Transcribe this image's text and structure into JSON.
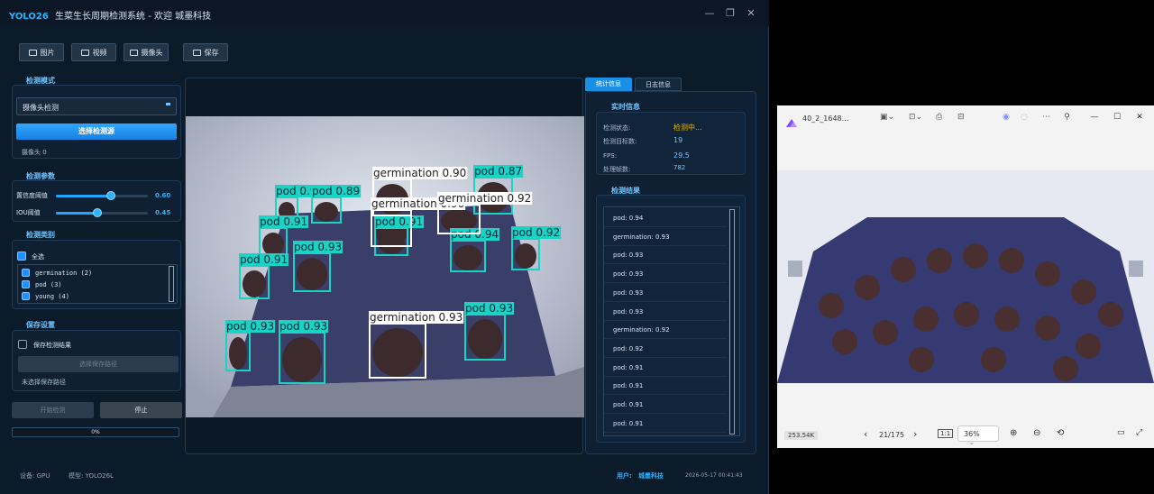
{
  "app": {
    "brand": "YOLO26",
    "title": "生菜生长周期检测系统 - 欢迎 城墨科技",
    "win": {
      "min": "—",
      "max": "❐",
      "close": "✕"
    }
  },
  "toolbar": {
    "image": "图片",
    "video": "视频",
    "camera": "摄像头",
    "save": "保存"
  },
  "mode": {
    "title": "检测模式",
    "selected": "摄像头检测",
    "button": "选择检测源",
    "camera_label": "摄像头 0"
  },
  "params": {
    "title": "检测参数",
    "conf_label": "置信度阈值",
    "conf_value": "0.60",
    "conf_fraction": 0.6,
    "iou_label": "IOU阈值",
    "iou_value": "0.45",
    "iou_fraction": 0.45
  },
  "classes": {
    "title": "检测类别",
    "all": "全选",
    "items": [
      "germination (2)",
      "pod (3)",
      "young (4)"
    ]
  },
  "save_settings": {
    "title": "保存设置",
    "save_results": "保存检测结果",
    "path_button": "选择保存路径",
    "path_hint": "未选择保存路径"
  },
  "actions": {
    "start": "开始检测",
    "stop": "停止"
  },
  "progress": {
    "text": "0%",
    "value": 0
  },
  "status": {
    "device": "设备: GPU",
    "model": "模型: YOLO26L",
    "user_label": "用户:",
    "user_name": "城墨科技",
    "datetime": "2026-05-17 00:41:43"
  },
  "detections": [
    {
      "label": "pod 0.91"
    },
    {
      "label": "pod 0.89"
    },
    {
      "label": "pod 0.91"
    },
    {
      "label": "pod 0.91"
    },
    {
      "label": "pod 0.93"
    },
    {
      "label": "pod 0.91"
    },
    {
      "label": "pod 0.94"
    },
    {
      "label": "pod 0.92"
    },
    {
      "label": "pod 0.87"
    },
    {
      "label": "germination 0.90"
    },
    {
      "label": "germination 0.90"
    },
    {
      "label": "germination 0.92"
    },
    {
      "label": "pod 0.93"
    },
    {
      "label": "pod 0.93"
    },
    {
      "label": "germination 0.93"
    },
    {
      "label": "pod 0.93"
    }
  ],
  "right_tabs": {
    "stats": "统计信息",
    "log": "日志信息"
  },
  "realtime": {
    "title": "实时信息",
    "rows": [
      {
        "label": "检测状态:",
        "value": "检测中..."
      },
      {
        "label": "检测目标数:",
        "value": "19"
      },
      {
        "label": "FPS:",
        "value": "29.5"
      },
      {
        "label": "处理帧数:",
        "value": "782"
      }
    ]
  },
  "results": {
    "title": "检测结果",
    "items": [
      "pod: 0.94",
      "germination: 0.93",
      "pod: 0.93",
      "pod: 0.93",
      "pod: 0.93",
      "pod: 0.93",
      "germination: 0.92",
      "pod: 0.92",
      "pod: 0.91",
      "pod: 0.91",
      "pod: 0.91",
      "pod: 0.91"
    ]
  },
  "viewer": {
    "title": "40_2_1648...",
    "file_size": "253.54K",
    "page": "21/175",
    "zoom": "36%"
  },
  "colors": {
    "accent": "#2bb3ff",
    "pod_box": "#19d3c5",
    "germination_box": "#ffffff"
  }
}
